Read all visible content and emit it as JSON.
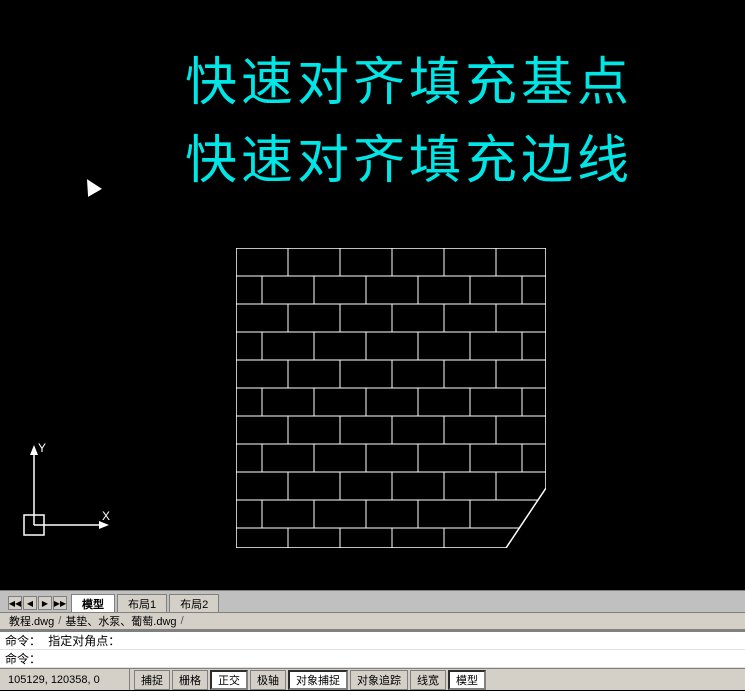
{
  "canvas": {
    "background": "#000000",
    "title1": "快速对齐填充基点",
    "title2": "快速对齐填充边线"
  },
  "tabs": {
    "model_label": "模型",
    "layout1_label": "布局1",
    "layout2_label": "布局2"
  },
  "file_path": {
    "file1": "教程.dwg",
    "separator1": "/",
    "file2": "基垫、水泵、葡萄.dwg",
    "separator2": "/"
  },
  "commands": {
    "line1": "命令：  指定对角点：",
    "line2": "命令："
  },
  "coordinates": "105129, 120358, 0",
  "status_buttons": {
    "snap": "捕捉",
    "grid": "栅格",
    "ortho": "正交",
    "polar": "极轴",
    "osnap": "对象捕捉",
    "otrack": "对象追踪",
    "linewidth": "线宽",
    "model": "模型"
  },
  "icons": {
    "cursor": "arrow-cursor",
    "axes_y": "Y",
    "axes_x": "X"
  }
}
